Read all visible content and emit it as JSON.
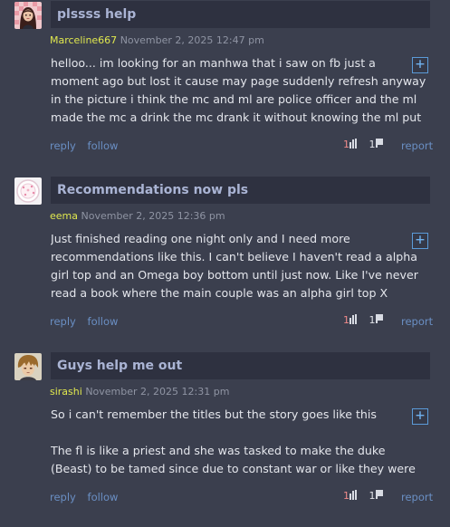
{
  "posts": [
    {
      "avatar": "girl-avatar",
      "title": "plssss help",
      "user": "Marceline667",
      "date": "November 2, 2025 12:47 pm",
      "body": "helloo... im looking for an manhwa that i saw on fb just a moment ago but lost it cause may page suddenly refresh anyway in the picture i think the mc and ml are police officer and the ml made the mc a drink the mc drank it without knowing the ml put his cum on",
      "expand_label": "+",
      "reply_label": "reply",
      "follow_label": "follow",
      "upvotes": "1",
      "downvotes": "1",
      "report_label": "report"
    },
    {
      "avatar": "cake-avatar",
      "title": "Recommendations now pls",
      "user": "eema",
      "date": "November 2, 2025 12:36 pm",
      "body": "Just finished reading one night only and I need more recommendations like this. I can't believe I haven't read a alpha girl top and an Omega boy bottom until just now. Like I've never read a book where the main couple was an alpha girl top X Omega",
      "expand_label": "+",
      "reply_label": "reply",
      "follow_label": "follow",
      "upvotes": "1",
      "downvotes": "1",
      "report_label": "report"
    },
    {
      "avatar": "anime-boy-avatar",
      "title": "Guys help me out",
      "user": "sirashi",
      "date": "November 2, 2025 12:31 pm",
      "body": "So i can't remember the titles but the story goes like this\n\nThe fl is like a priest and she was tasked to make the duke (Beast) to be tamed since due to constant war or like they were trained to",
      "expand_label": "+",
      "reply_label": "reply",
      "follow_label": "follow",
      "upvotes": "1",
      "downvotes": "1",
      "report_label": "report"
    }
  ],
  "icons": {
    "upvote": "thumbs-up-icon",
    "downvote": "thumbs-down-icon",
    "expand": "plus-icon"
  },
  "colors": {
    "background": "#3b3f4e",
    "title_bar": "#2e3140",
    "title_text": "#aab4d4",
    "username": "#e0e84e",
    "link": "#6a8fc4",
    "upvote_count": "#f08a8a"
  }
}
